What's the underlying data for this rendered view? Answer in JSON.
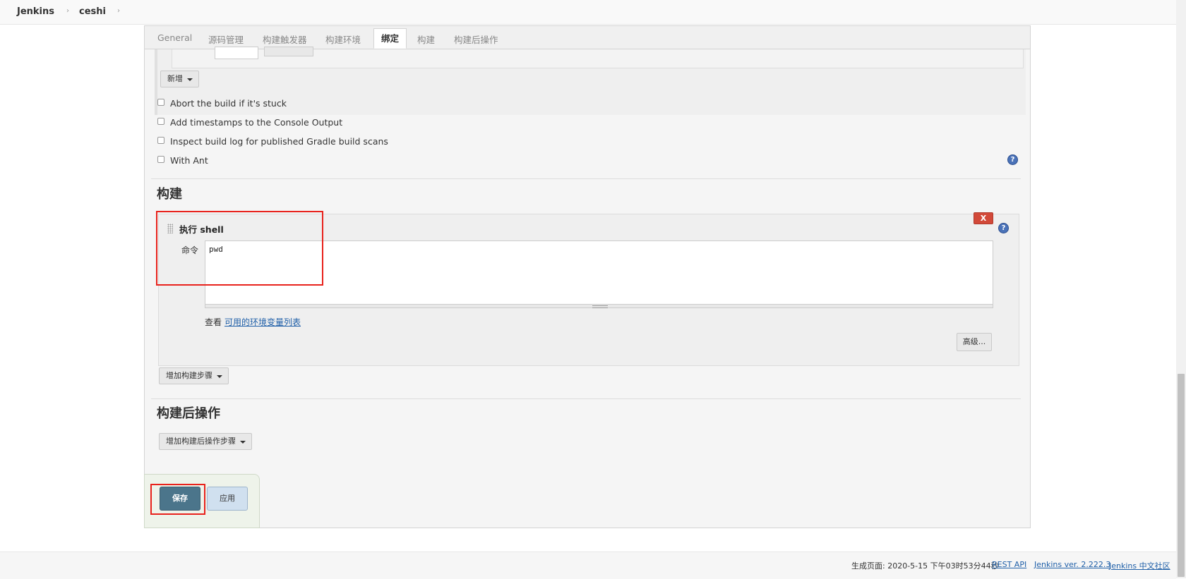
{
  "breadcrumb": {
    "items": [
      "Jenkins",
      "ceshi"
    ],
    "separator": "›"
  },
  "tabs": [
    "General",
    "源码管理",
    "构建触发器",
    "构建环境",
    "绑定",
    "构建",
    "构建后操作"
  ],
  "active_tab": "绑定",
  "bindings": {
    "add_button": "新增",
    "options": [
      {
        "label": "Abort the build if it's stuck",
        "checked": false
      },
      {
        "label": "Add timestamps to the Console Output",
        "checked": false
      },
      {
        "label": "Inspect build log for published Gradle build scans",
        "checked": false
      },
      {
        "label": "With Ant",
        "checked": false
      }
    ]
  },
  "build": {
    "title": "构建",
    "step_title": "执行 shell",
    "delete_label": "X",
    "command_label": "命令",
    "command_value": "pwd",
    "see_text": "查看",
    "env_link": "可用的环境变量列表",
    "advanced_button": "高级...",
    "add_step_button": "增加构建步骤"
  },
  "post_build": {
    "title": "构建后操作",
    "add_step_button": "增加构建后操作步骤"
  },
  "actions": {
    "save": "保存",
    "apply": "应用"
  },
  "help_symbol": "?",
  "footer": {
    "generated": "生成页面: 2020-5-15 下午03时53分44秒",
    "rest_api": "REST API",
    "version": "Jenkins ver. 2.222.3",
    "community": "Jenkins 中文社区"
  },
  "colors": {
    "save_button": "#4b758b",
    "apply_button": "#d0e0ef",
    "delete_button": "#d24939",
    "highlight": "#e8221c",
    "link": "#1f5fa8"
  }
}
